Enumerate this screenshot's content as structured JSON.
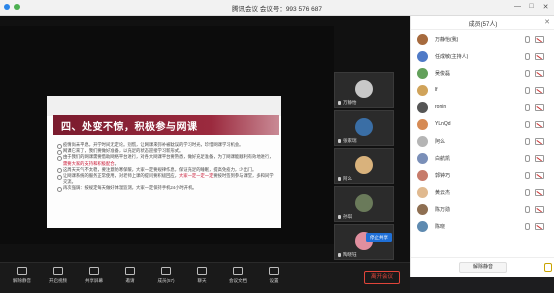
{
  "window": {
    "title": "腾讯会议 会议号：993 576 687",
    "minimize": "—",
    "maximize": "□",
    "close": "✕"
  },
  "slide": {
    "title": "四、处变不惊，积极参与网课",
    "bullets": [
      {
        "pre": "疫情尚未平息，开学时间无定论。别慌，让网课来弥补被耽误的学习时光，珍惜网课学习机会。",
        "hl": "",
        "post": ""
      },
      {
        "pre": "网课它来了，我们要做好准备，以充足的状态迎接学习新形式。",
        "hl": "",
        "post": ""
      },
      {
        "pre": "由于我们的网课需要借助网络平台进行，对各大网课平台要熟悉，做好充足准备，为了网课能顺利有效地进行，",
        "hl": "需要大家的支持和积极配合",
        "post": "。"
      },
      {
        "pre": "这周天天气不太稳，要注意防寒保暖，大家一定要规律作息，保证充足的睡眠，提高免疫力，少出门。",
        "hl": "",
        "post": ""
      },
      {
        "pre": "让网课系统的服务正常使用，对老师上课的提问要积极回应，",
        "hl": "大家一定一定一定",
        "post": "要按时签到参与课堂，多和同学交流。"
      },
      {
        "pre": "再次强调：按规定每天做好体温监测，大家一定保持手机24小时开机。",
        "hl": "",
        "post": ""
      }
    ]
  },
  "thumbnails": [
    {
      "name": "万静怡",
      "color": "#c8c8c8"
    },
    {
      "name": "张家瑞",
      "color": "#3a6ea5"
    },
    {
      "name": "阿么",
      "color": "#d9b27c"
    },
    {
      "name": "孙琪",
      "color": "#6a7a5a"
    },
    {
      "name": "陶晓钰",
      "color": "#e08f9f"
    }
  ],
  "share_stop_label": "停止共享",
  "toolbar": {
    "items": [
      "解除静音",
      "开启视频",
      "共享屏幕",
      "邀请",
      "成员(57)",
      "聊天",
      "会议文档",
      "设置"
    ],
    "end_label": "离开会议"
  },
  "panel": {
    "title": "成员(57人)",
    "close": "✕",
    "members": [
      {
        "name": "万静怡(我)",
        "color": "#a66a3e"
      },
      {
        "name": "任成敏(主持人)",
        "color": "#4f7ac7"
      },
      {
        "name": "吴俊磊",
        "color": "#62a05a"
      },
      {
        "name": "lf",
        "color": "#d0a35a"
      },
      {
        "name": "ronin",
        "color": "#555555"
      },
      {
        "name": "YLnQd",
        "color": "#d68a54"
      },
      {
        "name": "阿么",
        "color": "#b5b5b5"
      },
      {
        "name": "白航凯",
        "color": "#7a8fb8"
      },
      {
        "name": "郭钟巧",
        "color": "#c77b6a"
      },
      {
        "name": "黄云杰",
        "color": "#e0b98f"
      },
      {
        "name": "陈万勋",
        "color": "#8e6f52"
      },
      {
        "name": "陈晓",
        "color": "#5e8ab0"
      }
    ],
    "unmute_all_label": "解除静音"
  }
}
